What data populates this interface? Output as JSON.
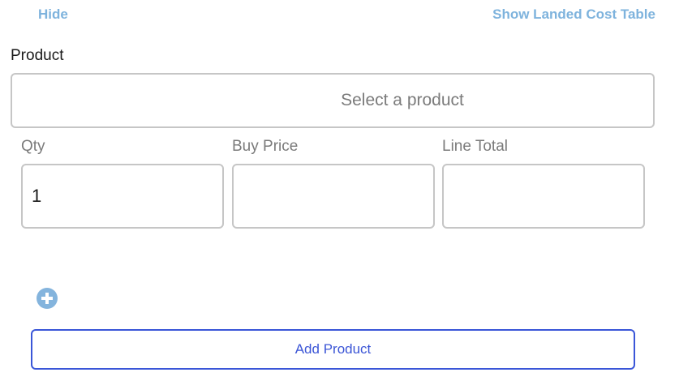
{
  "header": {
    "hide_label": "Hide",
    "landed_cost_label": "Show Landed Cost Table"
  },
  "product": {
    "label": "Product",
    "placeholder": "Select a product"
  },
  "line": {
    "qty_label": "Qty",
    "qty_value": "1",
    "price_label": "Buy Price",
    "price_value": "",
    "total_label": "Line Total",
    "total_value": ""
  },
  "actions": {
    "add_icon": "plus-circle-icon",
    "add_product_label": "Add Product"
  },
  "colors": {
    "link": "#7eb3dd",
    "accent": "#3b55d6",
    "border": "#c6c6c6"
  }
}
